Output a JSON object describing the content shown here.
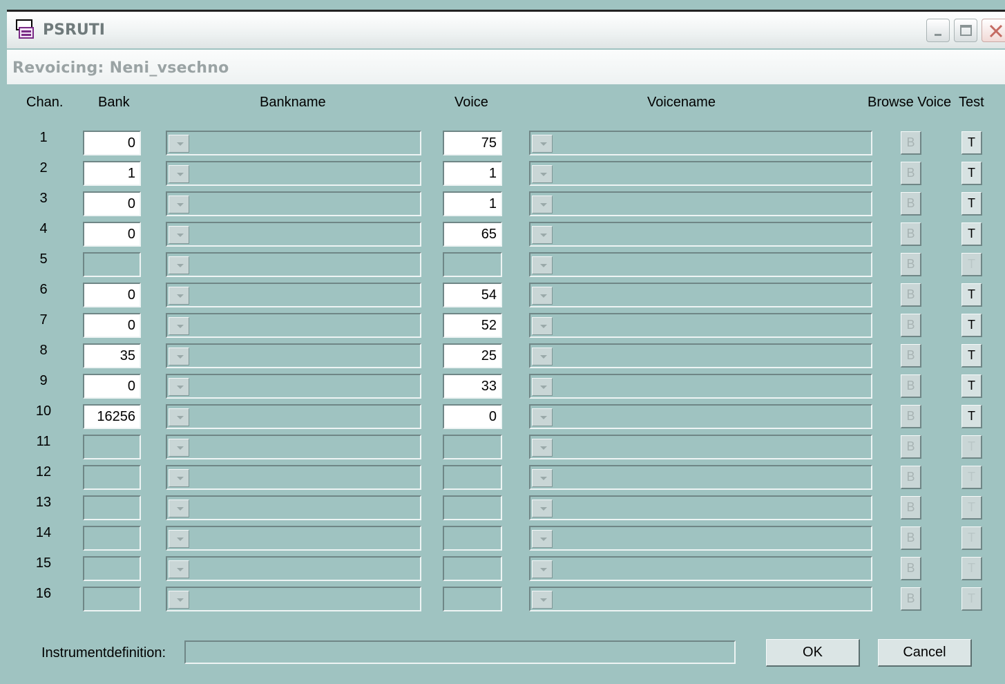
{
  "window": {
    "title": "PSRUTI",
    "subtitle": "Revoicing:  Neni_vsechno"
  },
  "headers": {
    "chan": "Chan.",
    "bank": "Bank",
    "bankname": "Bankname",
    "voice": "Voice",
    "voicename": "Voicename",
    "browse": "Browse Voice",
    "test": "Test"
  },
  "rows": [
    {
      "chan": "1",
      "bank": "0",
      "voice": "75",
      "active": true
    },
    {
      "chan": "2",
      "bank": "1",
      "voice": "1",
      "active": true
    },
    {
      "chan": "3",
      "bank": "0",
      "voice": "1",
      "active": true
    },
    {
      "chan": "4",
      "bank": "0",
      "voice": "65",
      "active": true
    },
    {
      "chan": "5",
      "bank": "",
      "voice": "",
      "active": false
    },
    {
      "chan": "6",
      "bank": "0",
      "voice": "54",
      "active": true
    },
    {
      "chan": "7",
      "bank": "0",
      "voice": "52",
      "active": true
    },
    {
      "chan": "8",
      "bank": "35",
      "voice": "25",
      "active": true
    },
    {
      "chan": "9",
      "bank": "0",
      "voice": "33",
      "active": true
    },
    {
      "chan": "10",
      "bank": "16256",
      "voice": "0",
      "active": true
    },
    {
      "chan": "11",
      "bank": "",
      "voice": "",
      "active": false
    },
    {
      "chan": "12",
      "bank": "",
      "voice": "",
      "active": false
    },
    {
      "chan": "13",
      "bank": "",
      "voice": "",
      "active": false
    },
    {
      "chan": "14",
      "bank": "",
      "voice": "",
      "active": false
    },
    {
      "chan": "15",
      "bank": "",
      "voice": "",
      "active": false
    },
    {
      "chan": "16",
      "bank": "",
      "voice": "",
      "active": false
    }
  ],
  "buttons": {
    "browse_label": "B",
    "test_label": "T",
    "ok": "OK",
    "cancel": "Cancel"
  },
  "footer": {
    "instrument_label": "Instrumentdefinition:",
    "instrument_value": ""
  },
  "icons": {
    "app": "psr-uti-app-icon",
    "minimize": "minimize-icon",
    "maximize": "maximize-icon",
    "close": "close-icon",
    "dropdown": "chevron-down-icon"
  }
}
